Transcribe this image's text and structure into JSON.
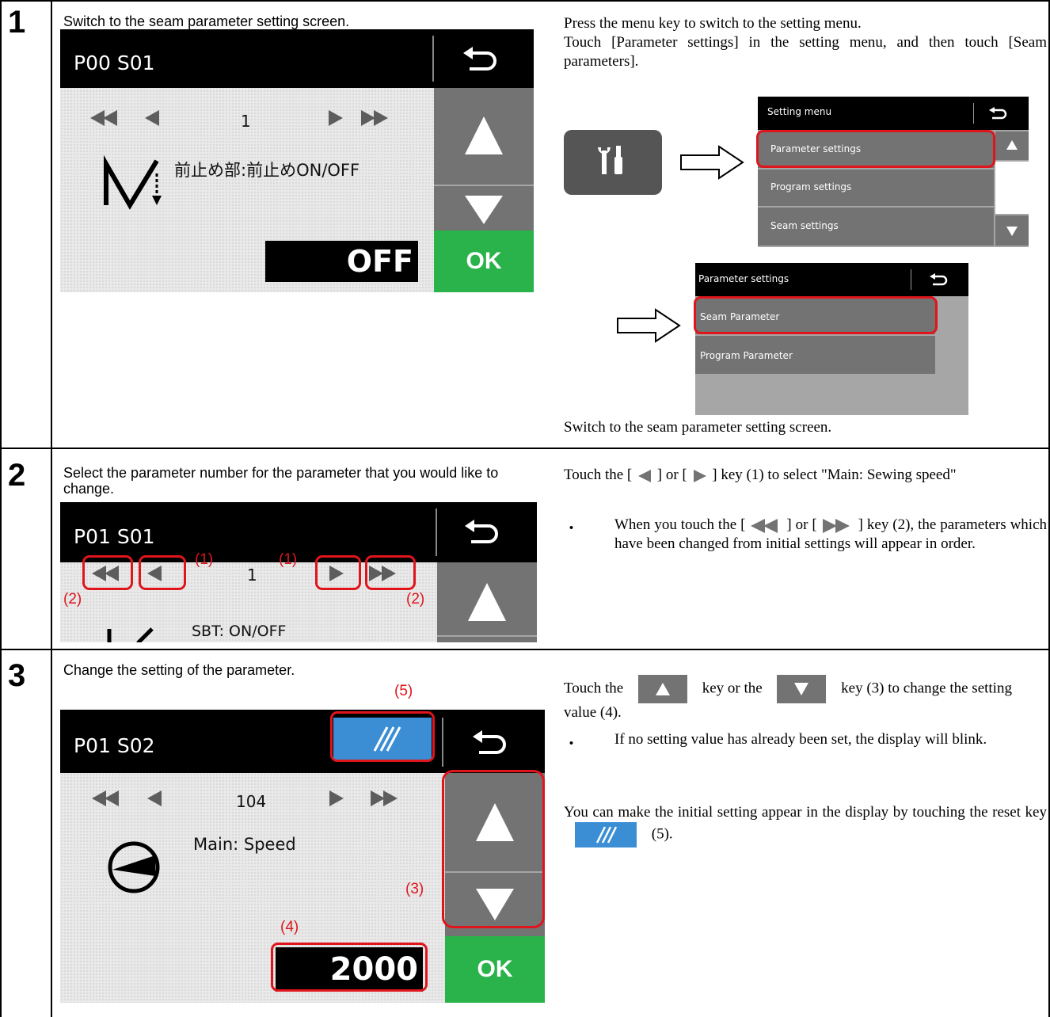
{
  "steps": [
    {
      "num": "1",
      "instruction": "Switch to the seam parameter setting screen.",
      "right_text_1": "Press the menu key to switch to the setting menu.",
      "right_text_2": "Touch [Parameter settings] in the setting menu, and then touch [Seam parameters].",
      "right_footer": "Switch to the seam parameter setting screen.",
      "screen": {
        "title": "P00 S01",
        "number": "1",
        "param_label": "前止め部:前止めON/OFF",
        "value": "OFF",
        "ok_label": "OK"
      },
      "setting_menu": {
        "title": "Setting menu",
        "items": [
          "Parameter settings",
          "Program settings",
          "Seam settings"
        ]
      },
      "parameter_menu": {
        "title": "Parameter settings",
        "items": [
          "Seam Parameter",
          "Program Parameter"
        ]
      }
    },
    {
      "num": "2",
      "instruction": "Select the parameter number for the parameter that you would like to change.",
      "right_text_1a": "Touch the [",
      "right_text_1b": "] or [",
      "right_text_1c": "] key (1) to select \"Main: Sewing speed\"",
      "bullet": "When you touch the [",
      "bullet_b": "] or [",
      "bullet_c": "] key (2), the parameters which have been changed from initial settings will appear in order.",
      "screen": {
        "title": "P01 S01",
        "number": "1",
        "param_label": "SBT: ON/OFF",
        "callout_1": "(1)",
        "callout_2": "(2)"
      }
    },
    {
      "num": "3",
      "instruction": "Change the setting of the parameter.",
      "right_a": "Touch the",
      "right_b": "key or the",
      "right_c": "key (3) to change the setting value (4).",
      "bullet": "If no setting value has already been set, the display will blink.",
      "reset_text_a": "You can make the initial setting appear in the display by touching the reset key",
      "reset_text_b": "(5).",
      "bullet_mark": "・",
      "screen": {
        "title": "P01 S02",
        "number": "104",
        "param_label": "Main: Speed",
        "value": "2000",
        "ok_label": "OK",
        "callout_3": "(3)",
        "callout_4": "(4)",
        "callout_5": "(5)"
      }
    }
  ],
  "colors": {
    "ok_green": "#2ab24b",
    "button_gray": "#737373",
    "reset_blue": "#3b8ed4",
    "callout_red": "#e0151c"
  }
}
